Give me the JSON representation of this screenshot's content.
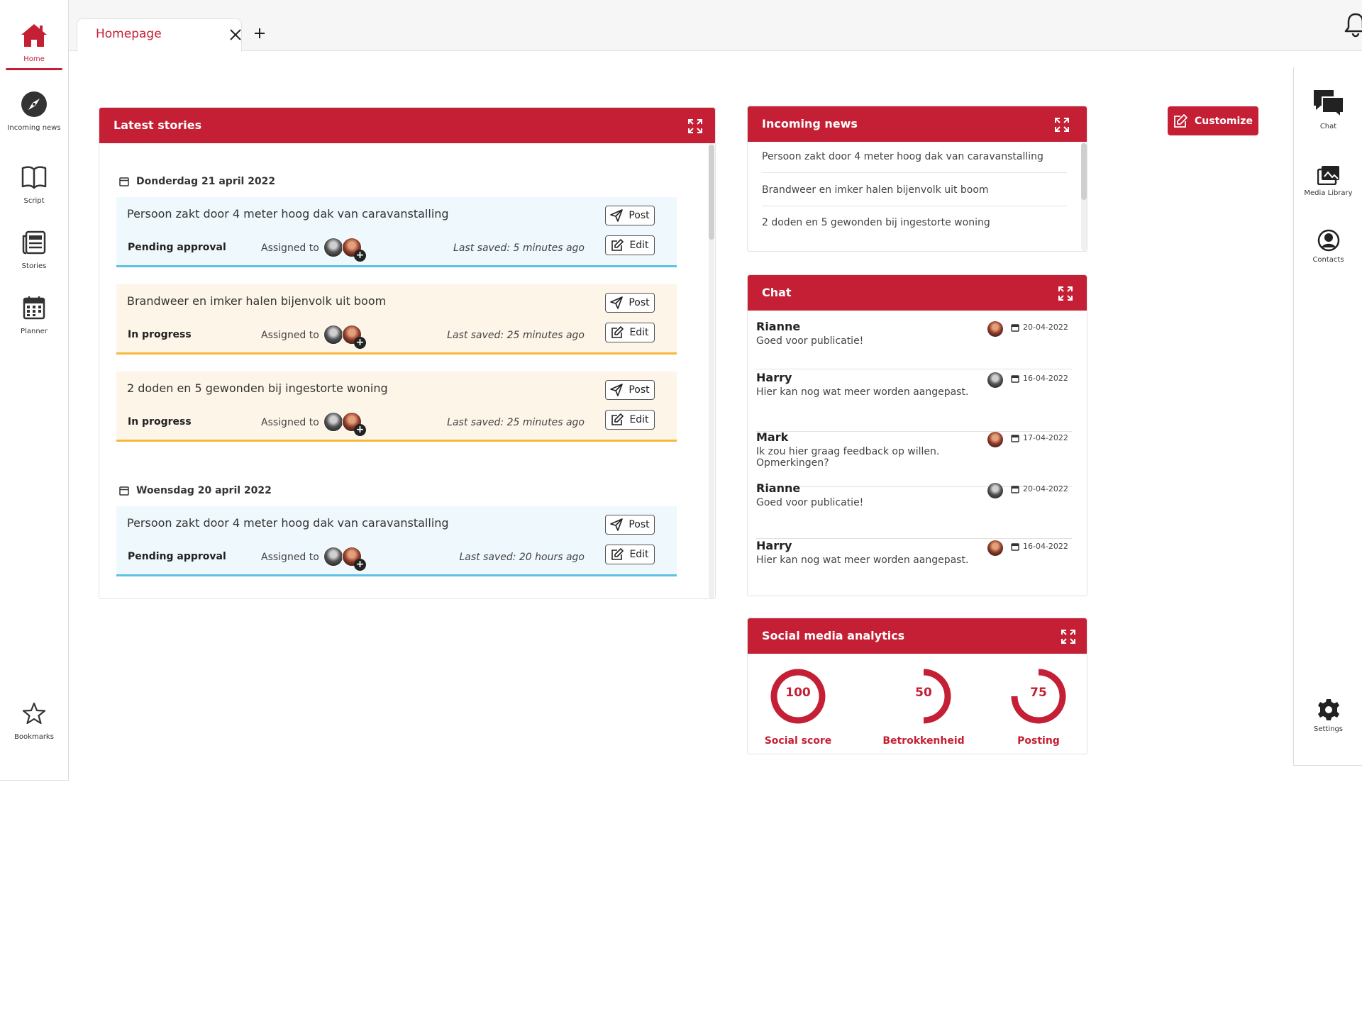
{
  "left_nav": {
    "items": [
      {
        "label": "Home"
      },
      {
        "label": "Incoming news"
      },
      {
        "label": "Script"
      },
      {
        "label": "Stories"
      },
      {
        "label": "Planner"
      },
      {
        "label": "Bookmarks"
      }
    ],
    "active": "Home"
  },
  "tabs": [
    {
      "label": "Homepage"
    }
  ],
  "right_nav": {
    "items": [
      {
        "label": "Chat"
      },
      {
        "label": "Media Library"
      },
      {
        "label": "Contacts"
      },
      {
        "label": "Settings"
      }
    ]
  },
  "customize_label": "Customize",
  "latest_stories": {
    "title": "Latest stories",
    "assigned_label": "Assigned to",
    "post_label": "Post",
    "edit_label": "Edit",
    "groups": [
      {
        "date": "Donderdag 21 april 2022",
        "stories": [
          {
            "title": "Persoon zakt door 4 meter hoog dak van caravanstalling",
            "status": "Pending approval",
            "last_saved": "Last saved: 5 minutes ago"
          },
          {
            "title": "Brandweer en imker halen bijenvolk uit boom",
            "status": "In progress",
            "last_saved": "Last saved: 25 minutes ago"
          },
          {
            "title": "2 doden en 5 gewonden bij ingestorte woning",
            "status": "In progress",
            "last_saved": "Last saved: 25 minutes ago"
          }
        ]
      },
      {
        "date": "Woensdag 20 april 2022",
        "stories": [
          {
            "title": "Persoon zakt door 4 meter hoog dak van caravanstalling",
            "status": "Pending approval",
            "last_saved": "Last saved:  20 hours ago"
          }
        ]
      }
    ]
  },
  "incoming_news": {
    "title": "Incoming news",
    "items": [
      "Persoon zakt door 4 meter hoog dak van caravanstalling",
      "Brandweer en imker halen bijenvolk uit boom",
      "2 doden en 5 gewonden bij ingestorte woning"
    ]
  },
  "chat": {
    "title": "Chat",
    "messages": [
      {
        "name": "Rianne",
        "text": "Goed voor publicatie!",
        "date": "20-04-2022"
      },
      {
        "name": "Harry",
        "text": "Hier kan nog wat meer worden aangepast.",
        "date": "16-04-2022"
      },
      {
        "name": "Mark",
        "text": "Ik zou hier graag feedback op willen. Opmerkingen?",
        "date": "17-04-2022"
      },
      {
        "name": "Rianne",
        "text": "Goed voor publicatie!",
        "date": "20-04-2022"
      },
      {
        "name": "Harry",
        "text": "Hier kan nog wat meer worden aangepast.",
        "date": "16-04-2022"
      }
    ]
  },
  "analytics": {
    "title": "Social media analytics",
    "metrics": [
      {
        "label": "Social score",
        "value": "100",
        "fraction": 1.0
      },
      {
        "label": "Betrokkenheid",
        "value": "50",
        "fraction": 0.5
      },
      {
        "label": "Posting",
        "value": "75",
        "fraction": 0.75
      }
    ]
  },
  "colors": {
    "accent": "#c41f34",
    "pending": "#5ec0e6",
    "progress": "#f5b93a"
  }
}
